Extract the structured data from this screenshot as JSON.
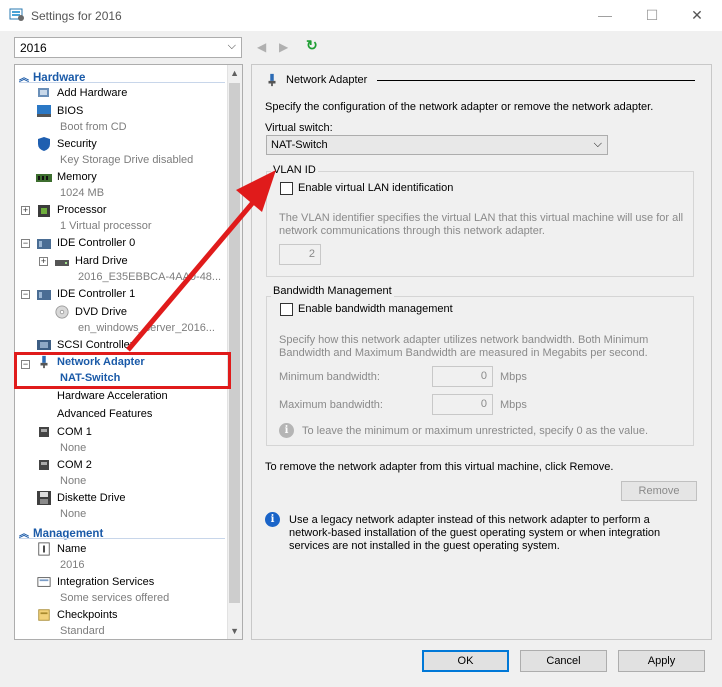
{
  "window": {
    "title": "Settings for 2016",
    "minimize_glyph": "—",
    "maximize_glyph": "☐",
    "close_glyph": "✕"
  },
  "vm_select": {
    "value": "2016"
  },
  "nav": {
    "back_glyph": "◀",
    "forward_glyph": "▶",
    "refresh_glyph": "↻"
  },
  "tree": {
    "hardware_label": "Hardware",
    "management_label": "Management",
    "items": {
      "add_hardware": "Add Hardware",
      "bios": "BIOS",
      "bios_sub": "Boot from CD",
      "security": "Security",
      "security_sub": "Key Storage Drive disabled",
      "memory": "Memory",
      "memory_sub": "1024 MB",
      "processor": "Processor",
      "processor_sub": "1 Virtual processor",
      "ide0": "IDE Controller 0",
      "hard_drive": "Hard Drive",
      "hard_drive_sub": "2016_E35EBBCA-4AA0-48...",
      "ide1": "IDE Controller 1",
      "dvd": "DVD Drive",
      "dvd_sub": "en_windows_server_2016...",
      "scsi": "SCSI Controller",
      "network_adapter": "Network Adapter",
      "network_adapter_sub": "NAT-Switch",
      "hw_accel": "Hardware Acceleration",
      "adv_features": "Advanced Features",
      "com1": "COM 1",
      "com1_sub": "None",
      "com2": "COM 2",
      "com2_sub": "None",
      "diskette": "Diskette Drive",
      "diskette_sub": "None",
      "name": "Name",
      "name_sub": "2016",
      "integration": "Integration Services",
      "integration_sub": "Some services offered",
      "checkpoints": "Checkpoints",
      "checkpoints_sub": "Standard"
    }
  },
  "panel": {
    "header": "Network Adapter",
    "description": "Specify the configuration of the network adapter or remove the network adapter.",
    "virtual_switch_label": "Virtual switch:",
    "virtual_switch_value": "NAT-Switch",
    "vlan_group_title": "VLAN ID",
    "vlan_checkbox_label": "Enable virtual LAN identification",
    "vlan_desc_1": "The VLAN identifier specifies the virtual LAN that this virtual machine will use for all",
    "vlan_desc_2": "network communications through this network adapter.",
    "vlan_value": "2",
    "bw_group_title": "Bandwidth Management",
    "bw_checkbox_label": "Enable bandwidth management",
    "bw_desc_1": "Specify how this network adapter utilizes network bandwidth. Both Minimum",
    "bw_desc_2": "Bandwidth and Maximum Bandwidth are measured in Megabits per second.",
    "min_bw_label": "Minimum bandwidth:",
    "min_bw_value": "0",
    "max_bw_label": "Maximum bandwidth:",
    "max_bw_value": "0",
    "unit": "Mbps",
    "bw_hint": "To leave the minimum or maximum unrestricted, specify 0 as the value.",
    "remove_text": "To remove the network adapter from this virtual machine, click Remove.",
    "remove_button": "Remove",
    "legacy_1": "Use a legacy network adapter instead of this network adapter to perform a",
    "legacy_2": "network-based installation of the guest operating system or when integration",
    "legacy_3": "services are not installed in the guest operating system."
  },
  "buttons": {
    "ok": "OK",
    "cancel": "Cancel",
    "apply": "Apply"
  },
  "colors": {
    "accent": "#1a5aa8",
    "annotation_red": "#e01b1b"
  }
}
